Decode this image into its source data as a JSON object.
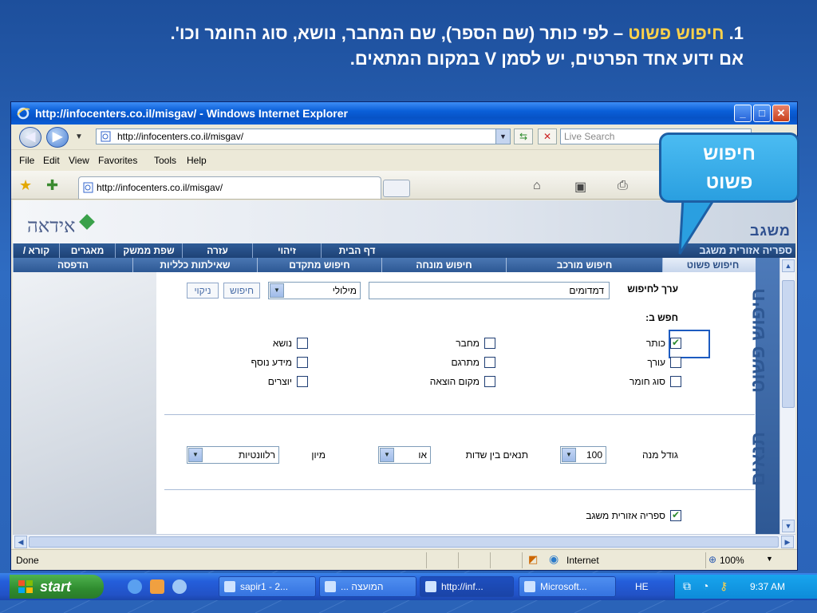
{
  "slide": {
    "heading_num": "1. ",
    "heading_accent": "חיפוש פשוט",
    "heading_rest": " – לפי כותר (שם הספר), שם המחבר, נושא, סוג החומר וכו'.",
    "heading_line2": "אם ידוע אחד הפרטים, יש לסמן V במקום המתאים."
  },
  "callout": {
    "line1": "חיפוש",
    "line2": "פשוט"
  },
  "window": {
    "title": "http://infocenters.co.il/misgav/ - Windows Internet Explorer",
    "address": "http://infocenters.co.il/misgav/",
    "search_placeholder": "Live Search",
    "tab_label": "http://infocenters.co.il/misgav/",
    "menu": [
      "File",
      "Edit",
      "View",
      "Favorites",
      "Tools",
      "Help"
    ]
  },
  "site": {
    "brand": "משגב",
    "library_name": "ספריה אזורית משגב",
    "topnav": [
      "קורא / חיפוש",
      "מאגרים",
      "שפת ממשק",
      "עזרה",
      "זיהוי",
      "דף הבית"
    ],
    "tabs": [
      "הדפסה",
      "שאילתות כלליות",
      "חיפוש מתקדם",
      "חיפוש מונחה",
      "חיפוש מורכב",
      "חיפוש פשוט"
    ],
    "side_label_1": "חיפוש פשוט",
    "side_label_2": "תנאים"
  },
  "form": {
    "search_value_label": "ערך לחיפוש",
    "search_value": "דמדומים",
    "match_select": "מילולי",
    "search_button": "חיפוש",
    "clear_button": "ניקוי",
    "search_in_label": "חפש ב:",
    "fields": {
      "title": "כותר",
      "author": "מחבר",
      "subject": "נושא",
      "editor": "עורך",
      "translator": "מתרגם",
      "extra_info": "מידע נוסף",
      "material_type": "סוג חומר",
      "publish_place": "מקום הוצאה",
      "creators": "יוצרים"
    },
    "quantity_label": "גודל מנה",
    "quantity_value": "100",
    "conditions_label": "תנאים בין שדות",
    "conditions_value": "או",
    "sort_label": "מיון",
    "sort_value": "רלוונטיות",
    "library_checkbox": "ספריה אזורית משגב"
  },
  "status": {
    "done": "Done",
    "zone": "Internet",
    "zoom": "100%"
  },
  "taskbar": {
    "start": "start",
    "items": [
      "sapir1 - 2...",
      "... המועצה",
      "http://inf...",
      "Microsoft..."
    ],
    "lang": "HE",
    "clock": "9:37 AM"
  }
}
